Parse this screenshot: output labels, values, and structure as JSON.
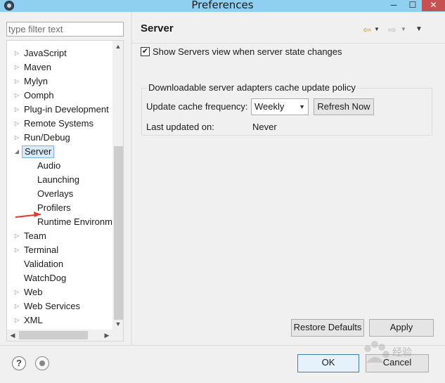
{
  "window": {
    "title": "Preferences",
    "minimize_glyph": "─",
    "maximize_glyph": "☐",
    "close_glyph": "✕"
  },
  "filter": {
    "placeholder": "type filter text"
  },
  "tree": {
    "items": [
      {
        "label": "JavaScript",
        "expandable": true
      },
      {
        "label": "Maven",
        "expandable": true
      },
      {
        "label": "Mylyn",
        "expandable": true
      },
      {
        "label": "Oomph",
        "expandable": true
      },
      {
        "label": "Plug-in Development",
        "expandable": true
      },
      {
        "label": "Remote Systems",
        "expandable": true
      },
      {
        "label": "Run/Debug",
        "expandable": true
      },
      {
        "label": "Server",
        "expandable": true,
        "expanded": true,
        "selected": true
      },
      {
        "label": "Audio",
        "child": true
      },
      {
        "label": "Launching",
        "child": true
      },
      {
        "label": "Overlays",
        "child": true
      },
      {
        "label": "Profilers",
        "child": true
      },
      {
        "label": "Runtime Environm",
        "child": true
      },
      {
        "label": "Team",
        "expandable": true
      },
      {
        "label": "Terminal",
        "expandable": true
      },
      {
        "label": "Validation"
      },
      {
        "label": "WatchDog"
      },
      {
        "label": "Web",
        "expandable": true
      },
      {
        "label": "Web Services",
        "expandable": true
      },
      {
        "label": "XML",
        "expandable": true
      }
    ]
  },
  "page": {
    "title": "Server",
    "show_servers_view": {
      "label": "Show Servers view when server state changes",
      "checked": true,
      "check_glyph": "✔"
    },
    "cache_group": {
      "title": "Downloadable server adapters cache update policy",
      "frequency_label": "Update cache frequency:",
      "frequency_value": "Weekly",
      "refresh_label": "Refresh Now",
      "last_updated_label": "Last updated on:",
      "last_updated_value": "Never"
    },
    "restore_defaults_label": "Restore Defaults",
    "apply_label": "Apply"
  },
  "footer": {
    "help_glyph": "?",
    "ok_label": "OK",
    "cancel_label": "Cancel"
  },
  "colors": {
    "titlebar": "#8fd0f0",
    "selection": "#d9ebf9",
    "annotation_arrow": "#e8372a"
  },
  "watermark": {
    "text": "经验"
  }
}
